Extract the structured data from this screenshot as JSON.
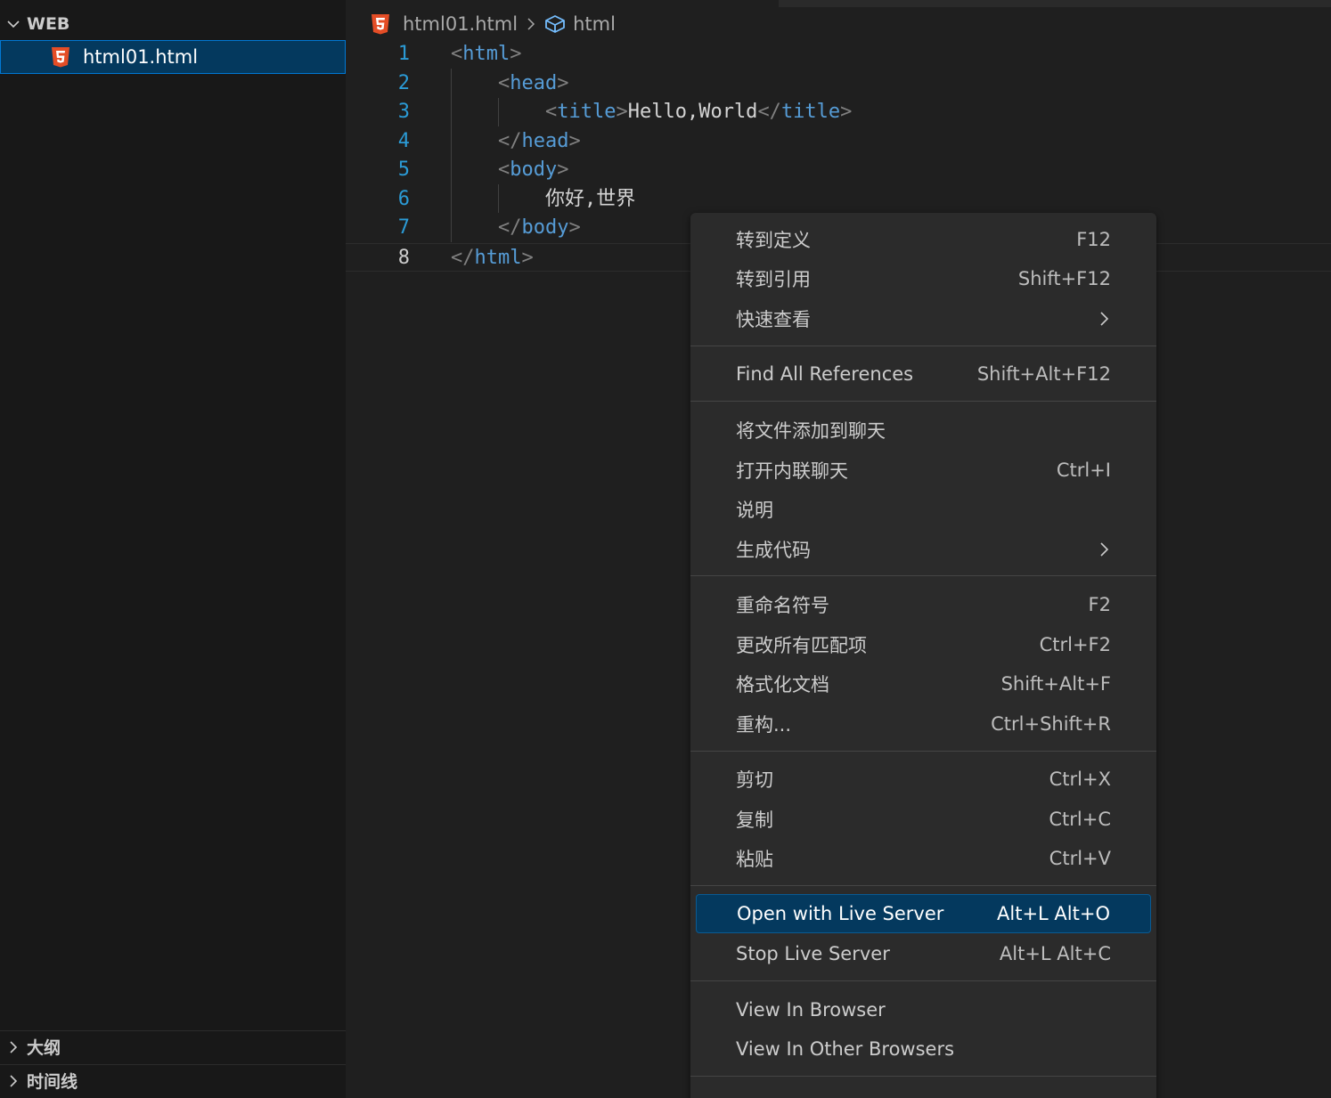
{
  "sidebar": {
    "folder_title": "WEB",
    "file_name": "html01.html",
    "outline_title": "大纲",
    "timeline_title": "时间线"
  },
  "breadcrumb": {
    "file": "html01.html",
    "symbol": "html"
  },
  "code": {
    "line_numbers": [
      "1",
      "2",
      "3",
      "4",
      "5",
      "6",
      "7",
      "8"
    ],
    "lines": [
      {
        "open": "<",
        "tag": "html",
        "close": ">"
      },
      {
        "open": "<",
        "tag": "head",
        "close": ">"
      },
      {
        "open": "<",
        "tag": "title",
        "close": ">",
        "text": "Hello,World",
        "open2": "</",
        "tag2": "title",
        "close2": ">"
      },
      {
        "open": "</",
        "tag": "head",
        "close": ">"
      },
      {
        "open": "<",
        "tag": "body",
        "close": ">"
      },
      {
        "text": "你好,世界"
      },
      {
        "open": "</",
        "tag": "body",
        "close": ">"
      },
      {
        "open": "</",
        "tag": "html",
        "close": ">"
      }
    ]
  },
  "context_menu": {
    "items": [
      {
        "label": "转到定义",
        "shortcut": "F12"
      },
      {
        "label": "转到引用",
        "shortcut": "Shift+F12"
      },
      {
        "label": "快速查看",
        "shortcut": ""
      },
      {
        "label": "Find All References",
        "shortcut": "Shift+Alt+F12"
      },
      {
        "label": "将文件添加到聊天",
        "shortcut": ""
      },
      {
        "label": "打开内联聊天",
        "shortcut": "Ctrl+I"
      },
      {
        "label": "说明",
        "shortcut": ""
      },
      {
        "label": "生成代码",
        "shortcut": ""
      },
      {
        "label": "重命名符号",
        "shortcut": "F2"
      },
      {
        "label": "更改所有匹配项",
        "shortcut": "Ctrl+F2"
      },
      {
        "label": "格式化文档",
        "shortcut": "Shift+Alt+F"
      },
      {
        "label": "重构...",
        "shortcut": "Ctrl+Shift+R"
      },
      {
        "label": "剪切",
        "shortcut": "Ctrl+X"
      },
      {
        "label": "复制",
        "shortcut": "Ctrl+C"
      },
      {
        "label": "粘贴",
        "shortcut": "Ctrl+V"
      },
      {
        "label": "Open with Live Server",
        "shortcut": "Alt+L Alt+O"
      },
      {
        "label": "Stop Live Server",
        "shortcut": "Alt+L Alt+C"
      },
      {
        "label": "View In Browser",
        "shortcut": ""
      },
      {
        "label": "View In Other Browsers",
        "shortcut": ""
      }
    ]
  },
  "colors": {
    "accent": "#0078d4",
    "selection": "#04395e",
    "html5_icon": "#e44d26",
    "tag_blue": "#569cd6",
    "line_number": "#2b9bd6"
  }
}
